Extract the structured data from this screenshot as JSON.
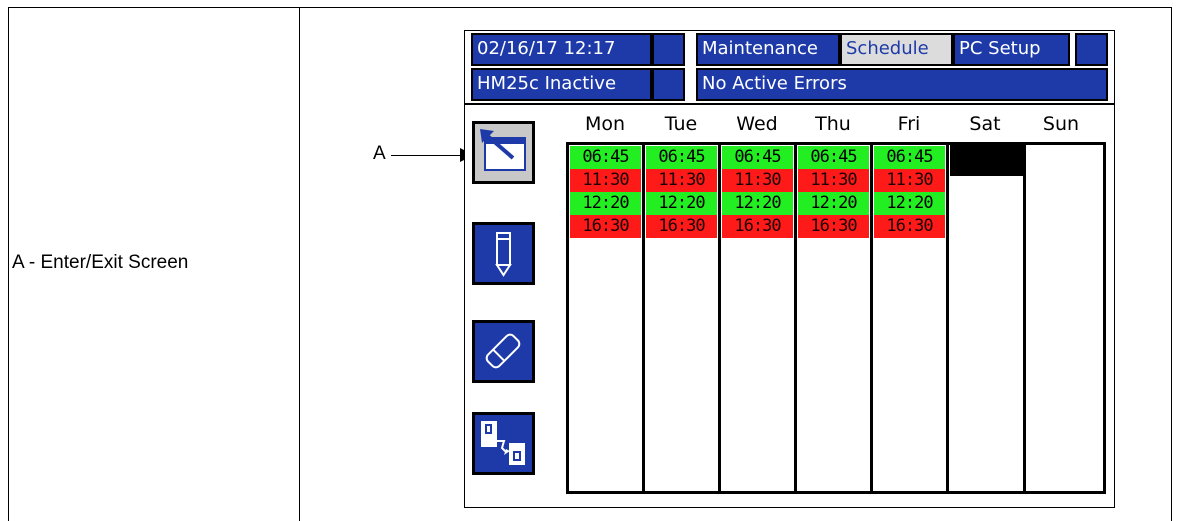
{
  "caption": {
    "text": "A - Enter/Exit Screen"
  },
  "callout": {
    "label": "A"
  },
  "header": {
    "datetime": "02/16/17 12:17",
    "tabs": [
      "Maintenance",
      "Schedule",
      "PC Setup"
    ],
    "active_tab": "Schedule",
    "status": "HM25c Inactive",
    "errors": "No Active Errors"
  },
  "schedule": {
    "days": [
      "Mon",
      "Tue",
      "Wed",
      "Thu",
      "Fri",
      "Sat",
      "Sun"
    ],
    "rows": [
      {
        "time": "06:45",
        "state": "on"
      },
      {
        "time": "11:30",
        "state": "off"
      },
      {
        "time": "12:20",
        "state": "on"
      },
      {
        "time": "16:30",
        "state": "off"
      }
    ],
    "weekday_times": [
      "06:45",
      "11:30",
      "12:20",
      "16:30"
    ]
  },
  "sidebar": {
    "buttons": [
      "enter-exit-screen",
      "edit",
      "erase",
      "copy"
    ]
  },
  "colors": {
    "panel_blue": "#1d3aa8",
    "on_green": "#22ee22",
    "off_red": "#ff1a1a"
  }
}
